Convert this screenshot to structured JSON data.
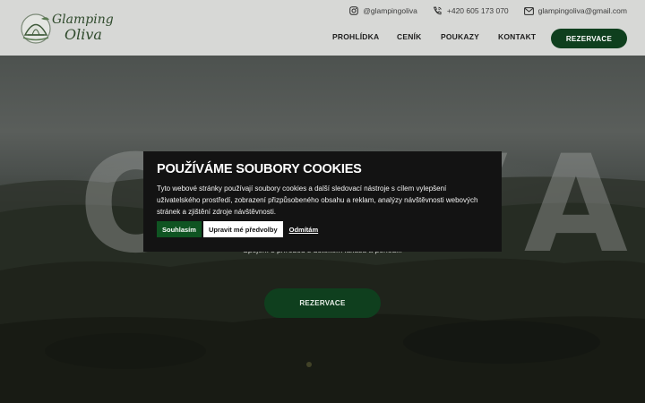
{
  "header": {
    "logo": {
      "line1": "Glamping",
      "line2": "Oliva"
    },
    "contacts": {
      "instagram": "@glampingoliva",
      "phone": "+420 605 173 070",
      "email": "glampingoliva@gmail.com"
    },
    "nav": [
      "PROHLÍDKA",
      "CENÍK",
      "POUKAZY",
      "KONTAKT"
    ],
    "reserve_label": "REZERVACE"
  },
  "hero": {
    "big_word": "OLIVA",
    "tagline": "Spojení s přírodou s dotekem luxusu a pohodlí.",
    "reserve_label": "REZERVACE"
  },
  "cookie": {
    "title": "POUŽÍVÁME SOUBORY COOKIES",
    "text": "Tyto webové stránky používají soubory cookies a další sledovací nástroje s cílem vylepšení uživatelského prostředí, zobrazení přizpůsobeného obsahu a reklam, analýzy návštěvnosti webových stránek a zjištění zdroje návštěvnosti.",
    "accept_label": "Souhlasím",
    "edit_label": "Upravit mé předvolby",
    "deny_label": "Odmítám"
  },
  "colors": {
    "brand_green": "#0f3f1e",
    "accept_green": "#0f5422",
    "header_bg": "#d7d8d6",
    "dialog_bg": "#131313"
  }
}
